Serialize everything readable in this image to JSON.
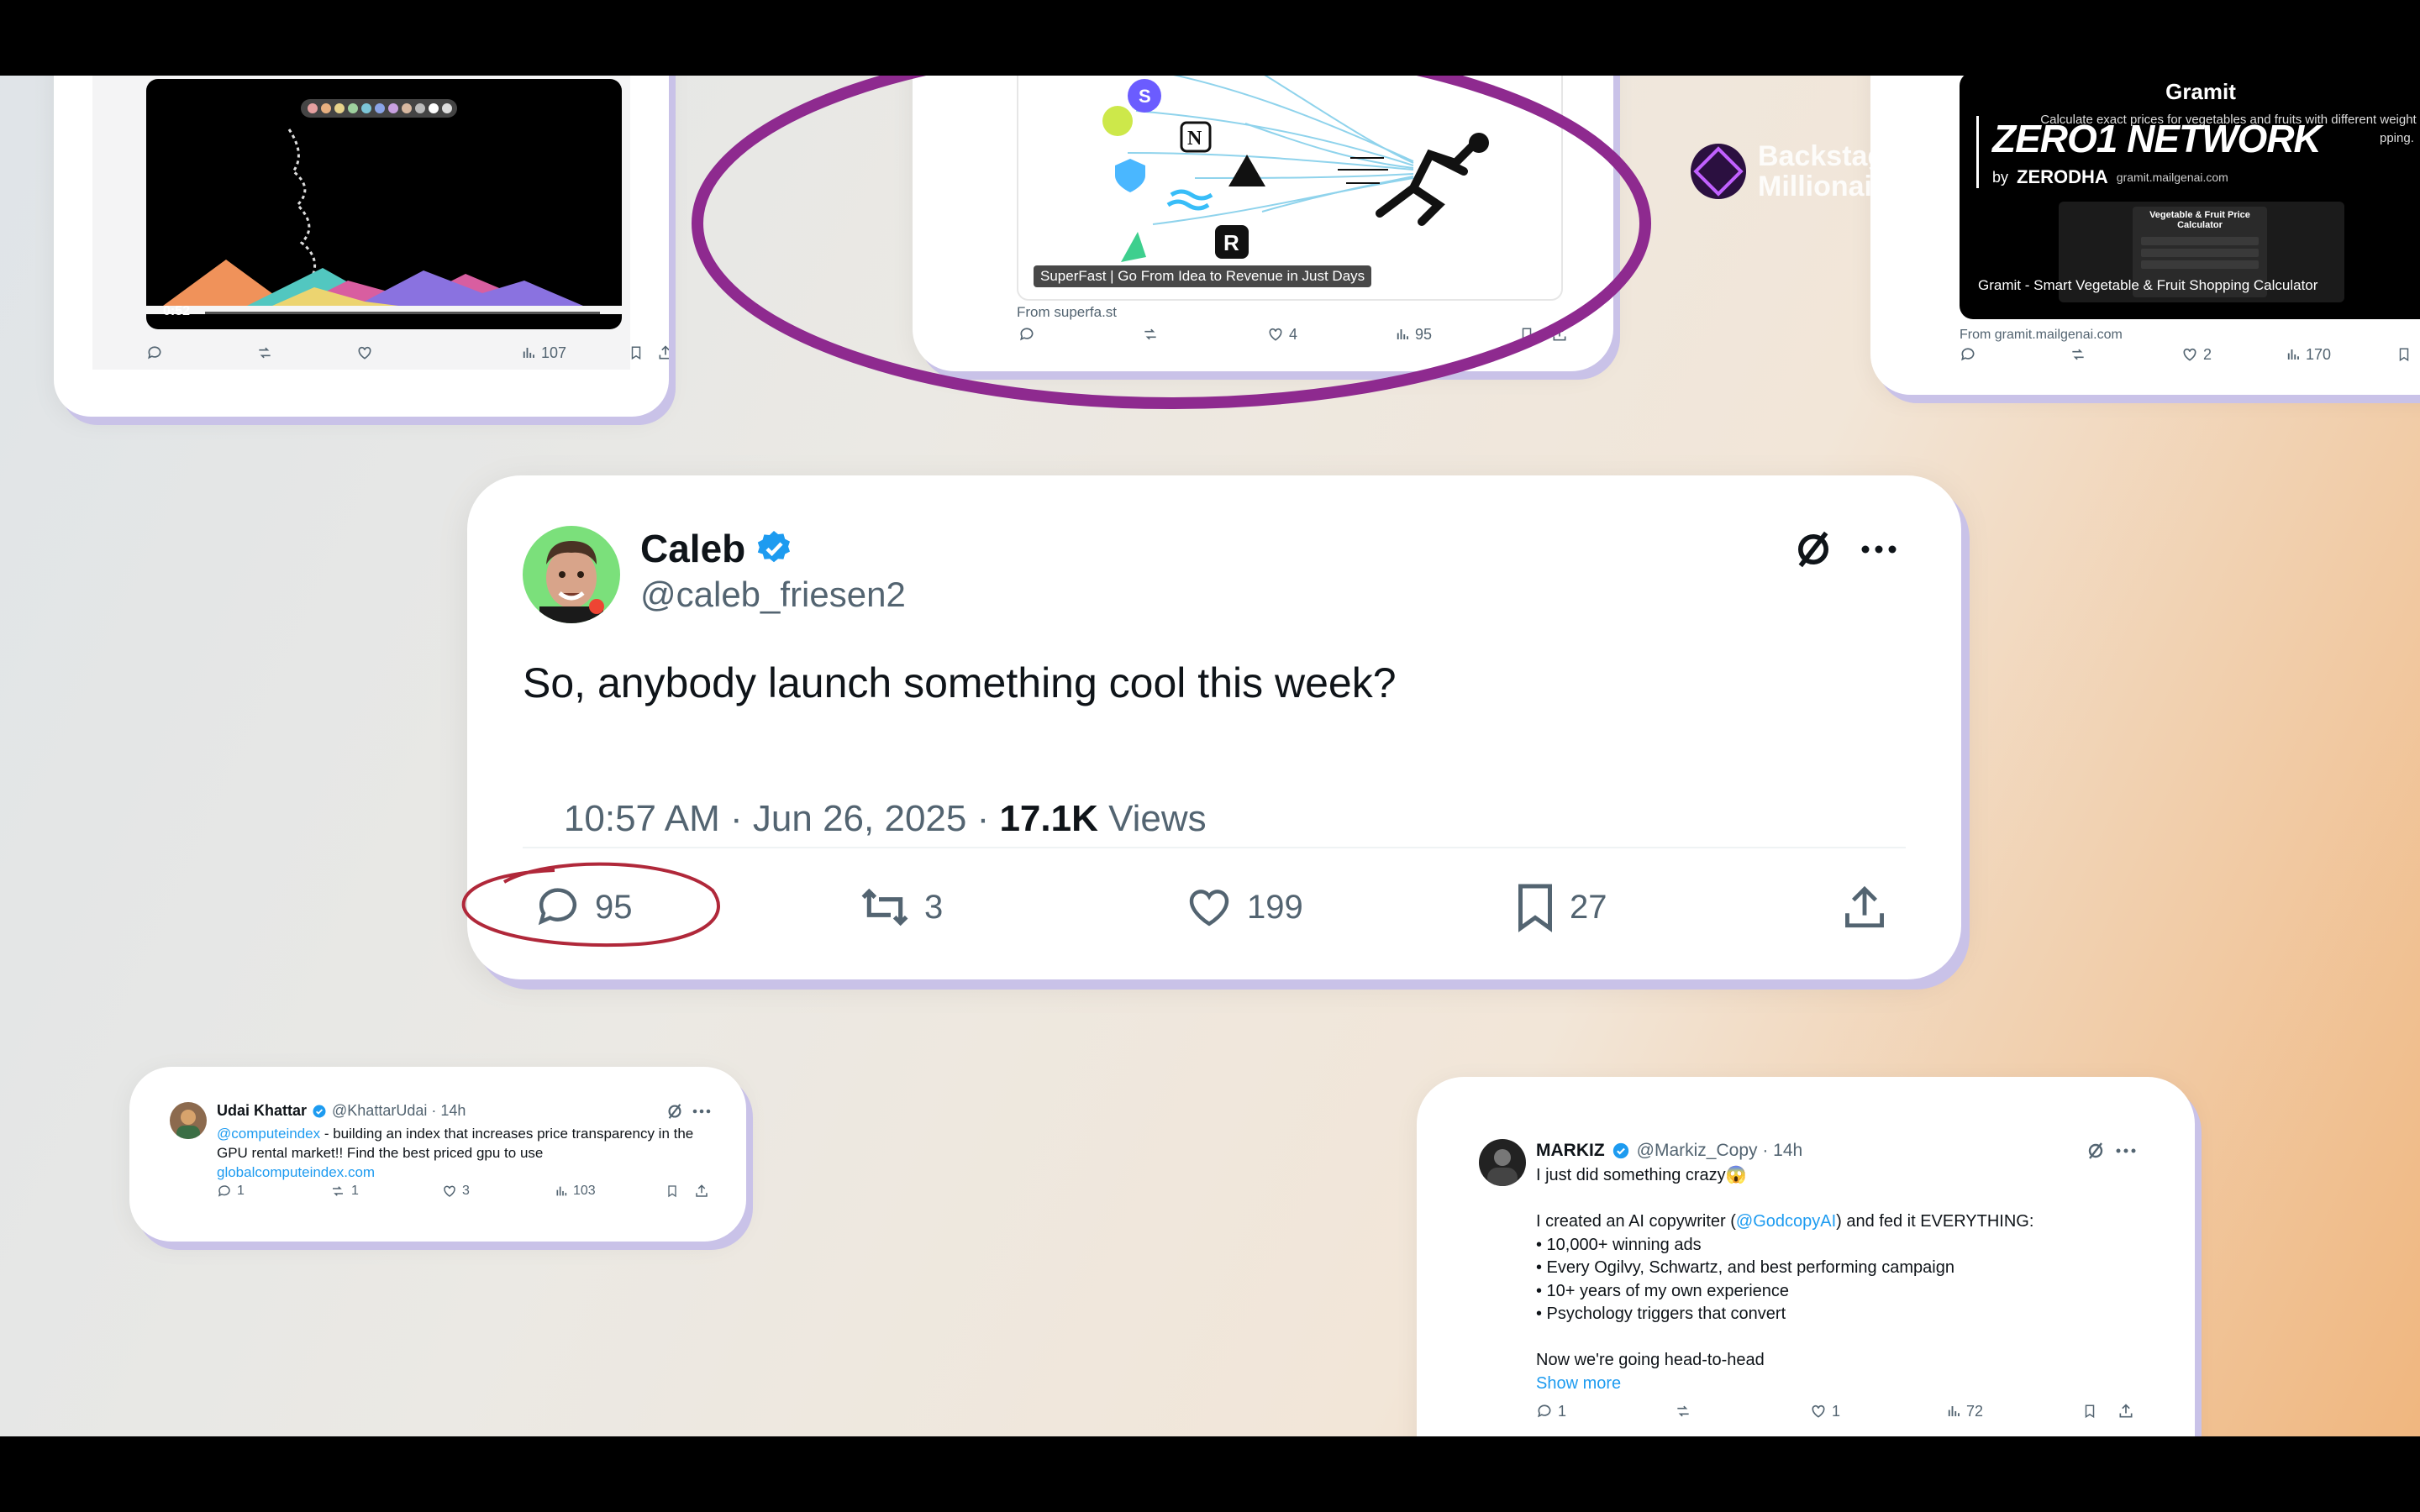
{
  "card_video": {
    "player_time": "0:52",
    "views": "107"
  },
  "card_superfast": {
    "caption": "SuperFast | Go From Idea to Revenue in Just Days",
    "source": "From superfa.st",
    "likes": "4",
    "views": "95"
  },
  "backstage": {
    "line1": "Backstage",
    "line2": "Millionaire"
  },
  "card_gramit": {
    "title": "Gramit",
    "description": "Calculate exact prices for vegetables and fruits with different weight",
    "description_tail": "pping.",
    "overlay_title": "ZERO1 NETWORK",
    "overlay_by": "by",
    "overlay_brand": "ZERODHA",
    "overlay_url": "gramit.mailgenai.com",
    "inner_title": "Vegetable & Fruit Price Calculator",
    "caption": "Gramit - Smart Vegetable & Fruit Shopping Calculator",
    "source": "From gramit.mailgenai.com",
    "likes": "2",
    "views": "170"
  },
  "main_tweet": {
    "name": "Caleb",
    "handle": "@caleb_friesen2",
    "text": "So, anybody launch something cool this week?",
    "time": "10:57 AM · Jun 26, 2025 · ",
    "views_count": "17.1K",
    "views_label": " Views",
    "replies": "95",
    "retweets": "3",
    "likes": "199",
    "bookmarks": "27"
  },
  "tweet_udai": {
    "name": "Udai Khattar",
    "handle_time": "@KhattarUdai · 14h",
    "mention": "@computeindex",
    "text_rest": " - building an index that increases price transparency in the",
    "text_line2": "GPU rental market!! Find the best priced gpu to use",
    "link": "globalcomputeindex.com",
    "replies": "1",
    "retweets": "1",
    "likes": "3",
    "views": "103"
  },
  "tweet_markiz": {
    "name": "MARKIZ",
    "handle_time": "@Markiz_Copy · 14h",
    "line1": "I just did something crazy😱",
    "line2_pre": "I created an AI copywriter (",
    "line2_mention": "@GodcopyAI",
    "line2_post": ") and fed it EVERYTHING:",
    "bullets": [
      "• 10,000+ winning ads",
      "• Every Ogilvy, Schwartz, and best performing campaign",
      "• 10+ years of my own experience",
      "• Psychology triggers that convert"
    ],
    "line_last": "Now we're going head-to-head",
    "show_more": "Show more",
    "replies": "1",
    "likes": "1",
    "views": "72"
  },
  "colors": {
    "highlight_purple": "#8e2a8f",
    "annotation_red": "#b0283a",
    "verified_blue": "#1d9bf0",
    "link_blue": "#1d9bf0"
  }
}
